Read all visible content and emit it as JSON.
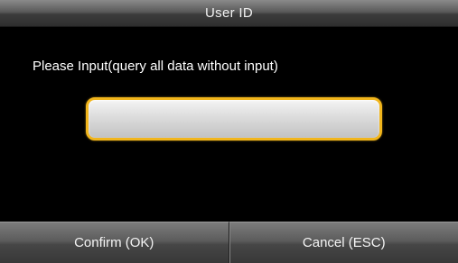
{
  "title": "User ID",
  "prompt": "Please Input(query all data without input)",
  "input": {
    "value": "",
    "accent_color": "#f1b51c"
  },
  "buttons": {
    "confirm_label": "Confirm (OK)",
    "cancel_label": "Cancel (ESC)"
  }
}
